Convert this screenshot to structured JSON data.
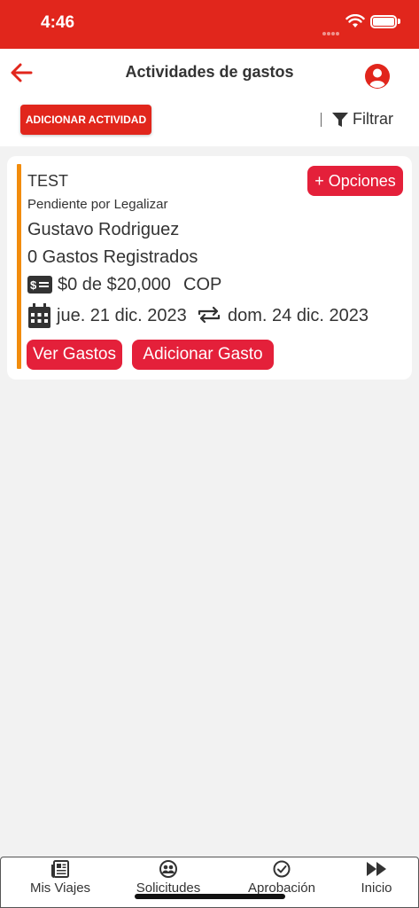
{
  "status_bar": {
    "time": "4:46"
  },
  "header": {
    "title": "Actividades de gastos",
    "add_activity_label": "ADICIONAR ACTIVIDAD",
    "filter_label": "Filtrar"
  },
  "activity": {
    "name": "TEST",
    "options_label": "+ Opciones",
    "status": "Pendiente por Legalizar",
    "person": "Gustavo Rodriguez",
    "expense_count": "0 Gastos Registrados",
    "amount": "$0 de $20,000",
    "currency": "COP",
    "start_date": "jue. 21 dic. 2023",
    "end_date": "dom. 24 dic. 2023",
    "view_expenses_label": "Ver Gastos",
    "add_expense_label": "Adicionar Gasto",
    "accent_color": "#f28c0c"
  },
  "tabs": [
    {
      "label": "Mis Viajes",
      "icon": "newspaper-icon"
    },
    {
      "label": "Solicitudes",
      "icon": "users-icon"
    },
    {
      "label": "Aprobación",
      "icon": "check-circle-icon"
    },
    {
      "label": "Inicio",
      "icon": "fast-forward-icon"
    }
  ],
  "colors": {
    "brand_red": "#e1261c",
    "button_red": "#e4203a",
    "background": "#f2f2f2"
  }
}
